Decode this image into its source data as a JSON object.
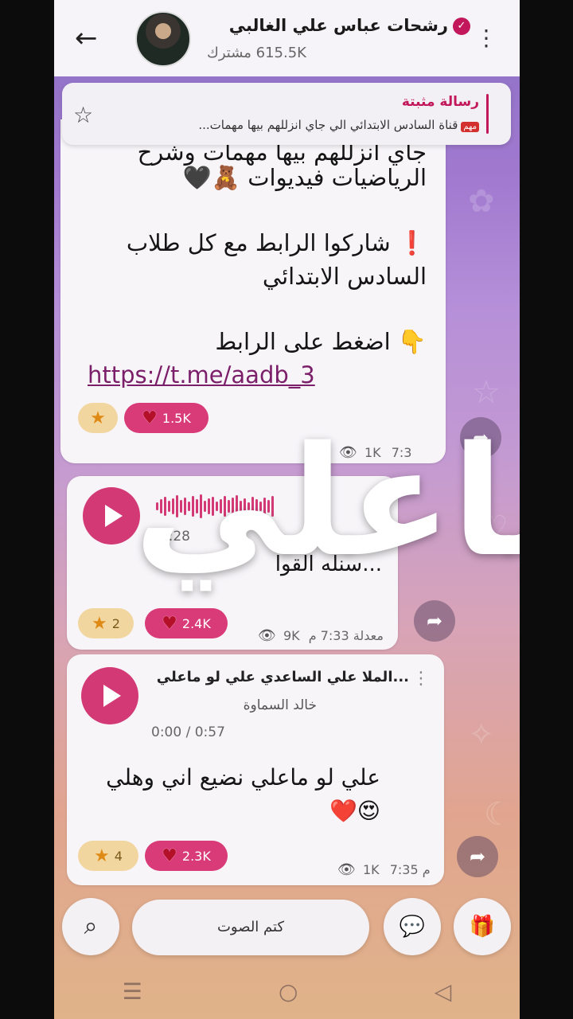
{
  "header": {
    "title": "رشحات عباس علي الغالبي",
    "subscribers": "615.5K مشترك"
  },
  "pinned": {
    "label": "رسالة مثبتة",
    "tag": "مهم",
    "text": "قناة السادس الابتدائي الي جاي انزللهم بيها مهمات..."
  },
  "message1": {
    "line1": "جاي انزللهم بيها مهمات وشرح",
    "line2": "الرياضيات فيديوات 🧸🖤",
    "line3": "❗️ شاركوا الرابط مع كل طلاب",
    "line4": "السادس الابتدائي",
    "line5": "👇 اضغط على الرابط",
    "link": "https://t.me/aadb_3",
    "heart_count": "1.5K",
    "views": "1K",
    "time": "7:3"
  },
  "message2": {
    "duration": "01:28",
    "caption": "...سنله القوا",
    "star_count": "2",
    "heart_count": "2.4K",
    "views": "9K",
    "time": "معدلة 7:33 م"
  },
  "message3": {
    "title": "...الملا علي الساعدي علي لو ماعلي",
    "artist": "خالد السماوة",
    "progress": "0:00 / 0:57",
    "line1": "علي لو ماعلي نضيع اني وهلي",
    "line2": "😍❤️",
    "star_count": "4",
    "heart_count": "2.3K",
    "views": "1K",
    "time": "7:35 م"
  },
  "overlay_text": "ياعلي",
  "bottom": {
    "mute_label": "كتم الصوت"
  },
  "icons": {
    "back": "←",
    "menu": "⋮",
    "pin": "☆",
    "share": "➦",
    "search": "⌕",
    "comment": "💬",
    "gift": "🎁",
    "eye": "👁",
    "star": "★",
    "heart": "♥"
  },
  "colors": {
    "accent": "#c2185b",
    "reaction_heart_bg": "#d93a78",
    "reaction_star_bg": "#f2d6a0"
  }
}
